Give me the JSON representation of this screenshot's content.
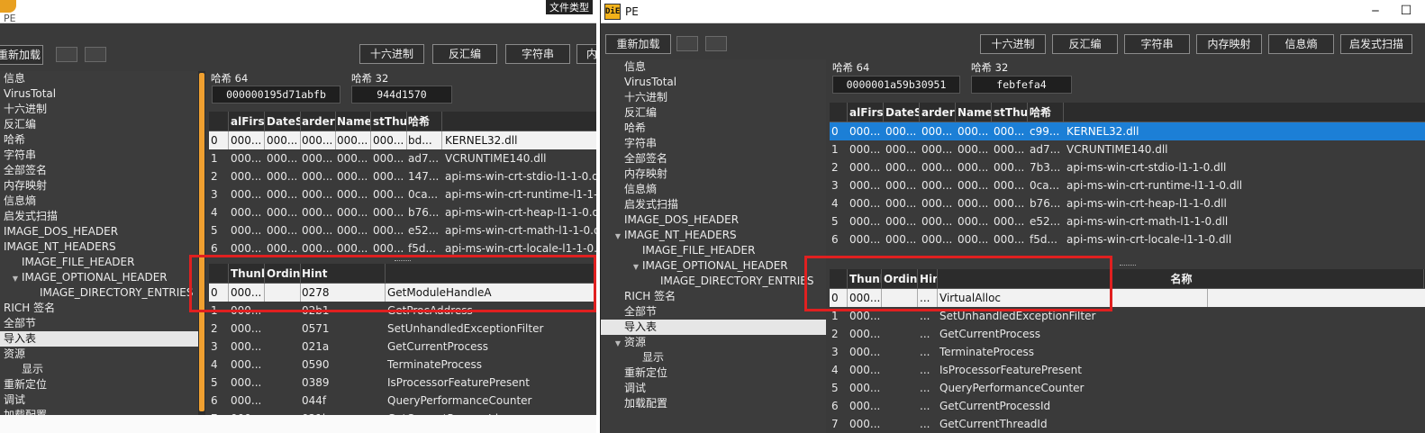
{
  "left_window": {
    "title": "PE",
    "backdrop_text": "文件类型",
    "toolbar": {
      "reload": "重新加载",
      "hex": "十六进制",
      "disasm": "反汇编",
      "strings": "字符串",
      "memmap": "内"
    },
    "tree": [
      {
        "label": "信息",
        "indent": 0
      },
      {
        "label": "VirusTotal",
        "indent": 0
      },
      {
        "label": "十六进制",
        "indent": 0
      },
      {
        "label": "反汇编",
        "indent": 0
      },
      {
        "label": "哈希",
        "indent": 0
      },
      {
        "label": "字符串",
        "indent": 0
      },
      {
        "label": "全部签名",
        "indent": 0
      },
      {
        "label": "内存映射",
        "indent": 0
      },
      {
        "label": "信息熵",
        "indent": 0
      },
      {
        "label": "启发式扫描",
        "indent": 0
      },
      {
        "label": "IMAGE_DOS_HEADER",
        "indent": 0
      },
      {
        "label": "IMAGE_NT_HEADERS",
        "indent": 0
      },
      {
        "label": "IMAGE_FILE_HEADER",
        "indent": 1
      },
      {
        "label": "IMAGE_OPTIONAL_HEADER",
        "indent": 1,
        "arrow": true
      },
      {
        "label": "IMAGE_DIRECTORY_ENTRIES",
        "indent": 2
      },
      {
        "label": "RICH 签名",
        "indent": 0
      },
      {
        "label": "全部节",
        "indent": 0
      },
      {
        "label": "导入表",
        "indent": 0,
        "selected": true
      },
      {
        "label": "资源",
        "indent": 0
      },
      {
        "label": "显示",
        "indent": 1
      },
      {
        "label": "重新定位",
        "indent": 0
      },
      {
        "label": "调试",
        "indent": 0
      },
      {
        "label": "加载配置",
        "indent": 0
      }
    ],
    "hash64_label": "哈希 64",
    "hash64_value": "000000195d71abfb",
    "hash32_label": "哈希 32",
    "hash32_value": "944d1570",
    "dll_headers": [
      "",
      "alFirst",
      "DateS",
      "arderC",
      "Name",
      "stThu",
      "哈希"
    ],
    "dll_rows": [
      [
        "0",
        "000...",
        "000...",
        "000...",
        "000...",
        "000...",
        "bd...",
        "KERNEL32.dll"
      ],
      [
        "1",
        "000...",
        "000...",
        "000...",
        "000...",
        "000...",
        "ad7...",
        "VCRUNTIME140.dll"
      ],
      [
        "2",
        "000...",
        "000...",
        "000...",
        "000...",
        "000...",
        "147...",
        "api-ms-win-crt-stdio-l1-1-0.dll"
      ],
      [
        "3",
        "000...",
        "000...",
        "000...",
        "000...",
        "000...",
        "0ca...",
        "api-ms-win-crt-runtime-l1-1-0.dll"
      ],
      [
        "4",
        "000...",
        "000...",
        "000...",
        "000...",
        "000...",
        "b76...",
        "api-ms-win-crt-heap-l1-1-0.dll"
      ],
      [
        "5",
        "000...",
        "000...",
        "000...",
        "000...",
        "000...",
        "e52...",
        "api-ms-win-crt-math-l1-1-0.dll"
      ],
      [
        "6",
        "000...",
        "000...",
        "000...",
        "000...",
        "000...",
        "f5d...",
        "api-ms-win-crt-locale-l1-1-0.dll"
      ]
    ],
    "func_headers": [
      "",
      "Thunk",
      "Ordina",
      "Hint",
      ""
    ],
    "func_rows": [
      [
        "0",
        "000...",
        "",
        "0278",
        "GetModuleHandleA"
      ],
      [
        "1",
        "000...",
        "",
        "02b1",
        "GetProcAddress"
      ],
      [
        "2",
        "000...",
        "",
        "0571",
        "SetUnhandledExceptionFilter"
      ],
      [
        "3",
        "000...",
        "",
        "021a",
        "GetCurrentProcess"
      ],
      [
        "4",
        "000...",
        "",
        "0590",
        "TerminateProcess"
      ],
      [
        "5",
        "000...",
        "",
        "0389",
        "IsProcessorFeaturePresent"
      ],
      [
        "6",
        "000...",
        "",
        "044f",
        "QueryPerformanceCounter"
      ],
      [
        "7",
        "000...",
        "",
        "021b",
        "GetCurrentProcessId"
      ]
    ]
  },
  "right_window": {
    "title": "PE",
    "logo_text": "DiE",
    "toolbar": {
      "reload": "重新加载",
      "hex": "十六进制",
      "disasm": "反汇编",
      "strings": "字符串",
      "memmap": "内存映射",
      "entropy": "信息熵",
      "heuristic": "启发式扫描"
    },
    "tree": [
      {
        "label": "信息",
        "indent": 0
      },
      {
        "label": "VirusTotal",
        "indent": 0
      },
      {
        "label": "十六进制",
        "indent": 0
      },
      {
        "label": "反汇编",
        "indent": 0
      },
      {
        "label": "哈希",
        "indent": 0
      },
      {
        "label": "字符串",
        "indent": 0
      },
      {
        "label": "全部签名",
        "indent": 0
      },
      {
        "label": "内存映射",
        "indent": 0
      },
      {
        "label": "信息熵",
        "indent": 0
      },
      {
        "label": "启发式扫描",
        "indent": 0
      },
      {
        "label": "IMAGE_DOS_HEADER",
        "indent": 0
      },
      {
        "label": "IMAGE_NT_HEADERS",
        "indent": 0,
        "arrow": true
      },
      {
        "label": "IMAGE_FILE_HEADER",
        "indent": 1
      },
      {
        "label": "IMAGE_OPTIONAL_HEADER",
        "indent": 1,
        "arrow": true
      },
      {
        "label": "IMAGE_DIRECTORY_ENTRIES",
        "indent": 2
      },
      {
        "label": "RICH 签名",
        "indent": 0
      },
      {
        "label": "全部节",
        "indent": 0
      },
      {
        "label": "导入表",
        "indent": 0,
        "selected": true
      },
      {
        "label": "资源",
        "indent": 0,
        "arrow": true
      },
      {
        "label": "显示",
        "indent": 1
      },
      {
        "label": "重新定位",
        "indent": 0
      },
      {
        "label": "调试",
        "indent": 0
      },
      {
        "label": "加载配置",
        "indent": 0
      }
    ],
    "hash64_label": "哈希 64",
    "hash64_value": "0000001a59b30951",
    "hash32_label": "哈希 32",
    "hash32_value": "febfefa4",
    "dll_headers": [
      "",
      "alFirst",
      "DateS",
      "arderC",
      "Name",
      "stThu",
      "哈希"
    ],
    "dll_rows": [
      [
        "0",
        "000...",
        "000...",
        "000...",
        "000...",
        "000...",
        "c99...",
        "KERNEL32.dll"
      ],
      [
        "1",
        "000...",
        "000...",
        "000...",
        "000...",
        "000...",
        "ad7...",
        "VCRUNTIME140.dll"
      ],
      [
        "2",
        "000...",
        "000...",
        "000...",
        "000...",
        "000...",
        "7b3...",
        "api-ms-win-crt-stdio-l1-1-0.dll"
      ],
      [
        "3",
        "000...",
        "000...",
        "000...",
        "000...",
        "000...",
        "0ca...",
        "api-ms-win-crt-runtime-l1-1-0.dll"
      ],
      [
        "4",
        "000...",
        "000...",
        "000...",
        "000...",
        "000...",
        "b76...",
        "api-ms-win-crt-heap-l1-1-0.dll"
      ],
      [
        "5",
        "000...",
        "000...",
        "000...",
        "000...",
        "000...",
        "e52...",
        "api-ms-win-crt-math-l1-1-0.dll"
      ],
      [
        "6",
        "000...",
        "000...",
        "000...",
        "000...",
        "000...",
        "f5d...",
        "api-ms-win-crt-locale-l1-1-0.dll"
      ]
    ],
    "func_headers": [
      "",
      "Thunk",
      "Ordina",
      "Hin",
      "名称"
    ],
    "func_rows": [
      [
        "0",
        "000...",
        "",
        "...",
        "VirtualAlloc"
      ],
      [
        "1",
        "000...",
        "",
        "...",
        "SetUnhandledExceptionFilter"
      ],
      [
        "2",
        "000...",
        "",
        "...",
        "GetCurrentProcess"
      ],
      [
        "3",
        "000...",
        "",
        "...",
        "TerminateProcess"
      ],
      [
        "4",
        "000...",
        "",
        "...",
        "IsProcessorFeaturePresent"
      ],
      [
        "5",
        "000...",
        "",
        "...",
        "QueryPerformanceCounter"
      ],
      [
        "6",
        "000...",
        "",
        "...",
        "GetCurrentProcessId"
      ],
      [
        "7",
        "000...",
        "",
        "...",
        "GetCurrentThreadId"
      ]
    ]
  },
  "colors": {
    "highlight_box": "#e02020",
    "selection_blue": "#1c7fd6",
    "scroll_thumb": "#f0a030",
    "background": "#3a3a3a"
  }
}
